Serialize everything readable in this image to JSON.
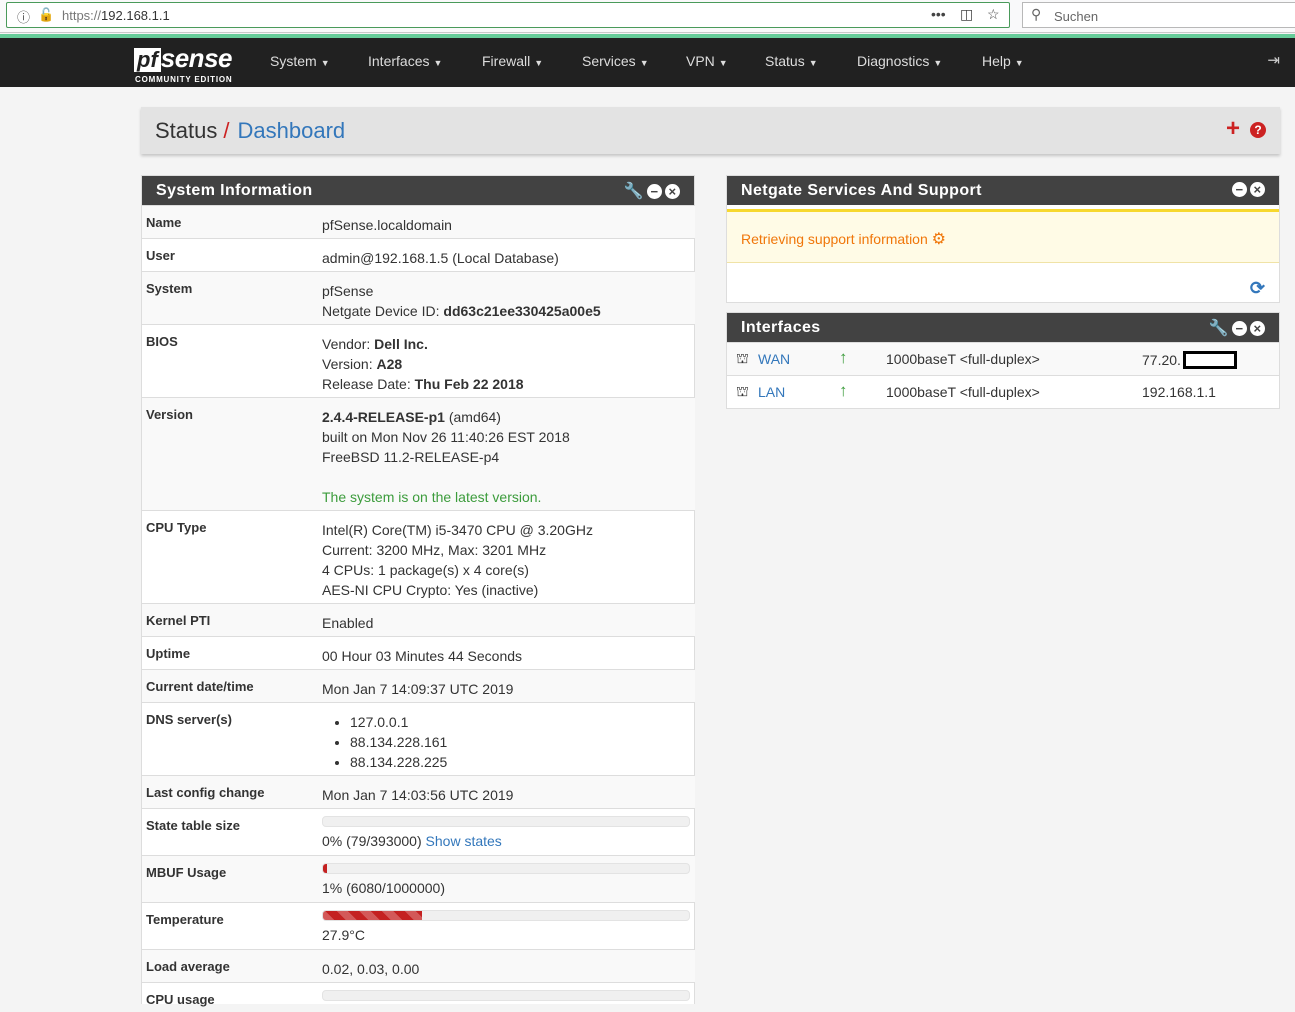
{
  "browser": {
    "url_proto": "https://",
    "url_host": "192.168.1.1",
    "search_placeholder": "Suchen",
    "menu_dots": "•••"
  },
  "nav": {
    "logo_pf": "pf",
    "logo_sense": "sense",
    "logo_edition": "COMMUNITY EDITION",
    "items": [
      "System",
      "Interfaces",
      "Firewall",
      "Services",
      "VPN",
      "Status",
      "Diagnostics",
      "Help"
    ]
  },
  "breadcrumb": {
    "section": "Status",
    "separator": "/",
    "page": "Dashboard"
  },
  "sysinfo": {
    "title": "System Information",
    "name_k": "Name",
    "name_v": "pfSense.localdomain",
    "user_k": "User",
    "user_v": "admin@192.168.1.5 (Local Database)",
    "system_k": "System",
    "system_v1": "pfSense",
    "system_v2_label": "Netgate Device ID: ",
    "system_v2_val": "dd63c21ee330425a00e5",
    "bios_k": "BIOS",
    "bios_vendor_label": "Vendor: ",
    "bios_vendor": "Dell Inc.",
    "bios_version_label": "Version: ",
    "bios_version": "A28",
    "bios_date_label": "Release Date: ",
    "bios_date": "Thu Feb 22 2018",
    "version_k": "Version",
    "version_v1": "2.4.4-RELEASE-p1",
    "version_v1b": " (amd64)",
    "version_v2": "built on Mon Nov 26 11:40:26 EST 2018",
    "version_v3": "FreeBSD 11.2-RELEASE-p4",
    "version_status": "The system is on the latest version.",
    "cpu_k": "CPU Type",
    "cpu_v1": "Intel(R) Core(TM) i5-3470 CPU @ 3.20GHz",
    "cpu_v2": "Current: 3200 MHz, Max: 3201 MHz",
    "cpu_v3": "4 CPUs: 1 package(s) x 4 core(s)",
    "cpu_v4": "AES-NI CPU Crypto: Yes (inactive)",
    "pti_k": "Kernel PTI",
    "pti_v": "Enabled",
    "uptime_k": "Uptime",
    "uptime_v": "00 Hour 03 Minutes 44 Seconds",
    "date_k": "Current date/time",
    "date_v": "Mon Jan 7 14:09:37 UTC 2019",
    "dns_k": "DNS server(s)",
    "dns": [
      "127.0.0.1",
      "88.134.228.161",
      "88.134.228.225"
    ],
    "cfg_k": "Last config change",
    "cfg_v": "Mon Jan 7 14:03:56 UTC 2019",
    "state_k": "State table size",
    "state_v": "0% (79/393000)",
    "state_link": "Show states",
    "mbuf_k": "MBUF Usage",
    "mbuf_v": "1% (6080/1000000)",
    "temp_k": "Temperature",
    "temp_v": "27.9°C",
    "load_k": "Load average",
    "load_v": "0.02, 0.03, 0.00",
    "cpuuse_k": "CPU usage"
  },
  "levels": {
    "state_pct": 0,
    "mbuf_pct": 1,
    "temp_pct": 27
  },
  "netgate": {
    "title": "Netgate Services And Support",
    "message": "Retrieving support information"
  },
  "interfaces": {
    "title": "Interfaces",
    "rows": [
      {
        "name": "WAN",
        "media": "1000baseT <full-duplex>",
        "ip": "77.20."
      },
      {
        "name": "LAN",
        "media": "1000baseT <full-duplex>",
        "ip": "192.168.1.1"
      }
    ]
  },
  "colors": {
    "accent": "#3377bb",
    "danger": "#c42121",
    "ok": "#3c9c3c",
    "warning": "#f0760a"
  }
}
